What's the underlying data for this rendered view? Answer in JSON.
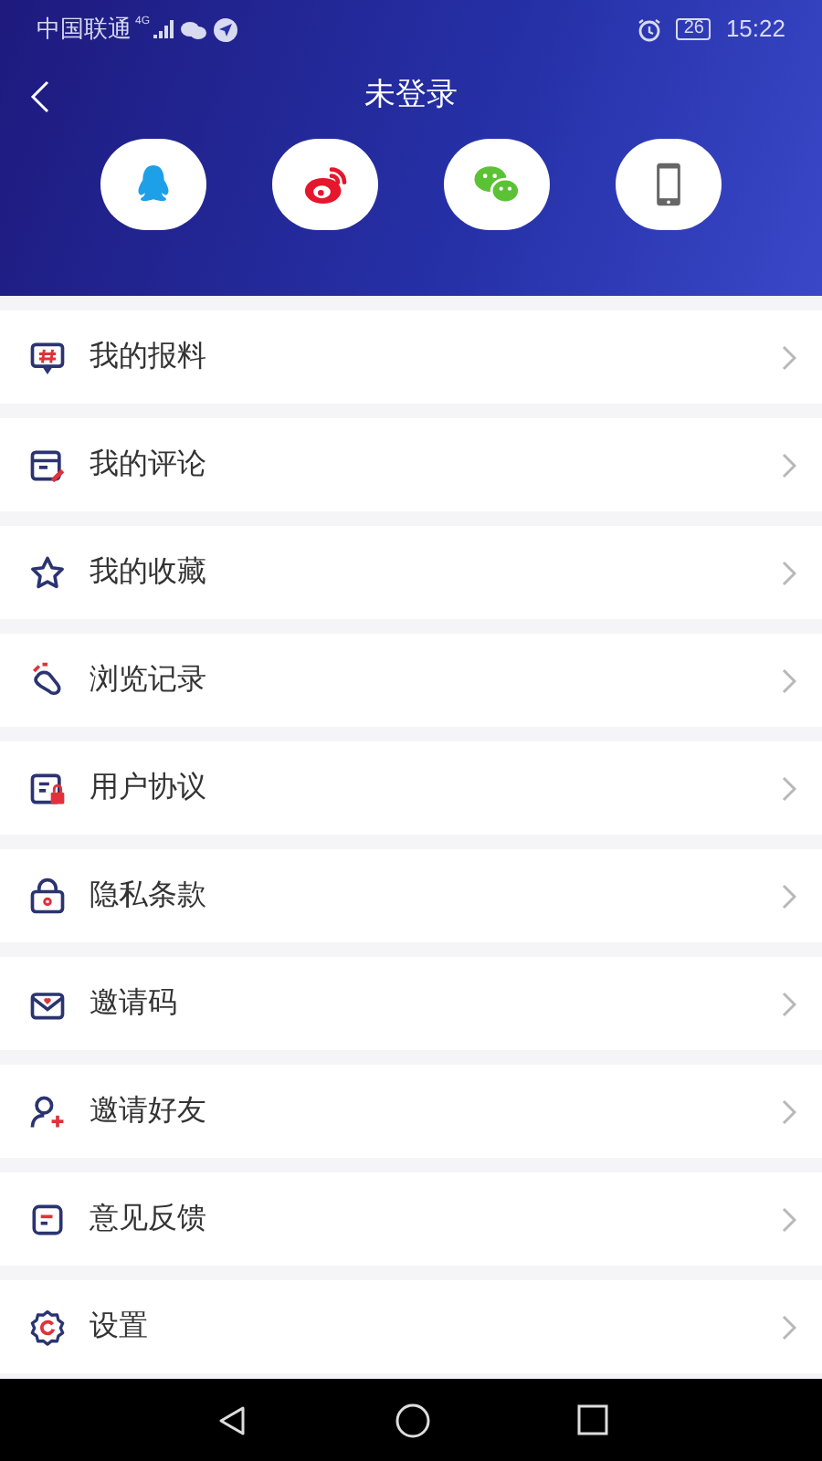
{
  "status_bar": {
    "carrier": "中国联通",
    "network": "4G",
    "battery": "26",
    "time": "15:22"
  },
  "header": {
    "title": "未登录"
  },
  "menu": [
    {
      "label": "我的报料"
    },
    {
      "label": "我的评论"
    },
    {
      "label": "我的收藏"
    },
    {
      "label": "浏览记录"
    },
    {
      "label": "用户协议"
    },
    {
      "label": "隐私条款"
    },
    {
      "label": "邀请码"
    },
    {
      "label": "邀请好友"
    },
    {
      "label": "意见反馈"
    },
    {
      "label": "设置"
    }
  ]
}
